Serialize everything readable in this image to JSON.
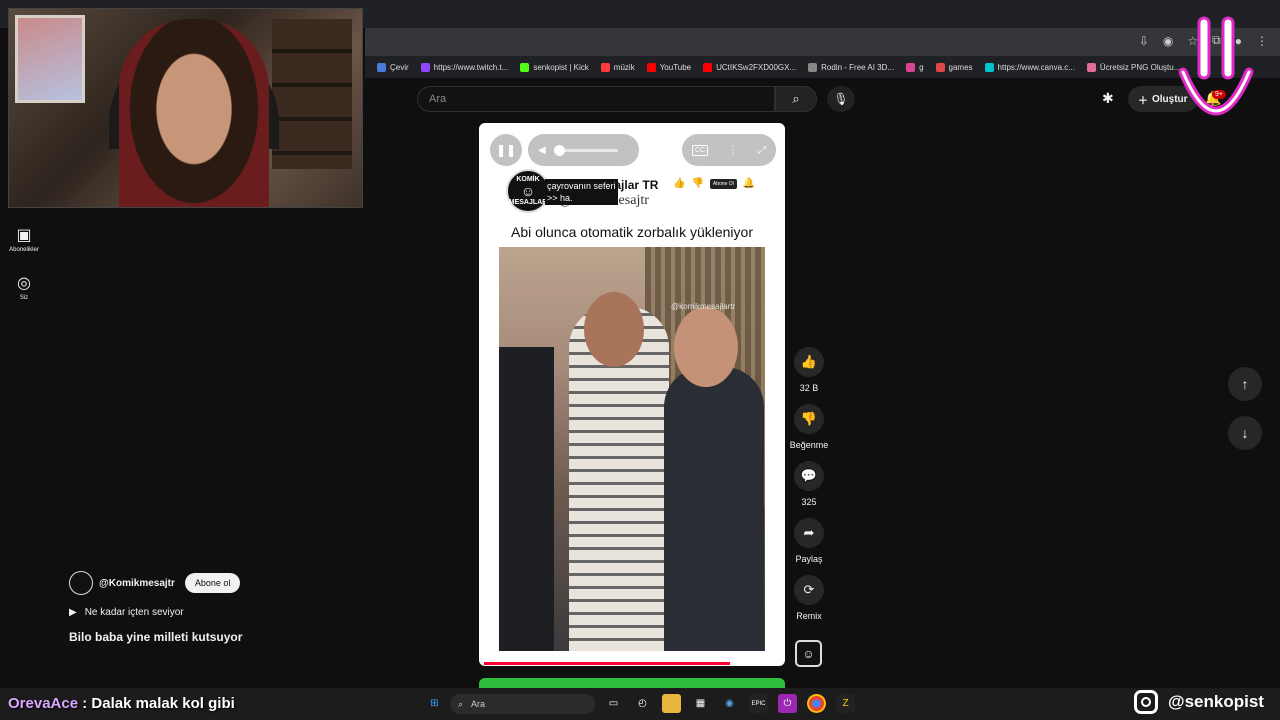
{
  "browser": {
    "bookmarks": [
      {
        "label": "Çevir",
        "color": "#4a7bd8"
      },
      {
        "label": "https://www.twitch.t...",
        "color": "#9146ff"
      },
      {
        "label": "senkopist | Kick",
        "color": "#53fc18"
      },
      {
        "label": "müzik",
        "color": "#ff3b3b"
      },
      {
        "label": "YouTube",
        "color": "#ff0000"
      },
      {
        "label": "UCtIKSw2FXD00GX...",
        "color": "#ff0000"
      },
      {
        "label": "Rodin - Free AI 3D...",
        "color": "#888888"
      },
      {
        "label": "g",
        "color": "#d6458f"
      },
      {
        "label": "games",
        "color": "#e04848"
      },
      {
        "label": "https://www.canva.c...",
        "color": "#00c4cc"
      },
      {
        "label": "Ücretsiz PNG Oluştu...",
        "color": "#e56b9b"
      }
    ]
  },
  "header": {
    "search_placeholder": "Ara",
    "create_label": "Oluştur",
    "notif_count": "9+"
  },
  "sidebar": {
    "items": [
      {
        "label": "Abonelikler",
        "icon": "subscriptions-icon"
      },
      {
        "label": "Siz",
        "icon": "profile-icon"
      }
    ]
  },
  "short": {
    "channel_name": "Komik Mesajlar TR",
    "channel_handle": "@komikmesajtr",
    "tooltip_line1": "çayrovanın seferi",
    "tooltip_line2": ">> ha.",
    "subscribe_label": "Abone Ol",
    "avatar_text_top": "KOMİK",
    "avatar_text_bottom": "MESAJLAR",
    "title": "Abi olunca otomatik zorbalık yükleniyor",
    "watermark": "@komikmesajlartr",
    "cc_label": "CC",
    "progress": 0.83
  },
  "actions": [
    {
      "name": "like",
      "icon": "👍",
      "label": "32 B"
    },
    {
      "name": "dislike",
      "icon": "👎",
      "label": "Beğenme"
    },
    {
      "name": "comments",
      "icon": "💬",
      "label": "325"
    },
    {
      "name": "share",
      "icon": "➦",
      "label": "Paylaş"
    },
    {
      "name": "remix",
      "icon": "⟳",
      "label": "Remix"
    }
  ],
  "next_short": {
    "handle": "@Komikmesajtr",
    "subscribe": "Abone ol",
    "sound": "Ne kadar içten seviyor",
    "title": "Bilo baba yine milleti kutsuyor"
  },
  "taskbar": {
    "search_placeholder": "Ara"
  },
  "overlay": {
    "chat_user": "OrevaAce",
    "chat_message": " : Dalak malak kol gibi",
    "instagram": "@senkopist"
  }
}
